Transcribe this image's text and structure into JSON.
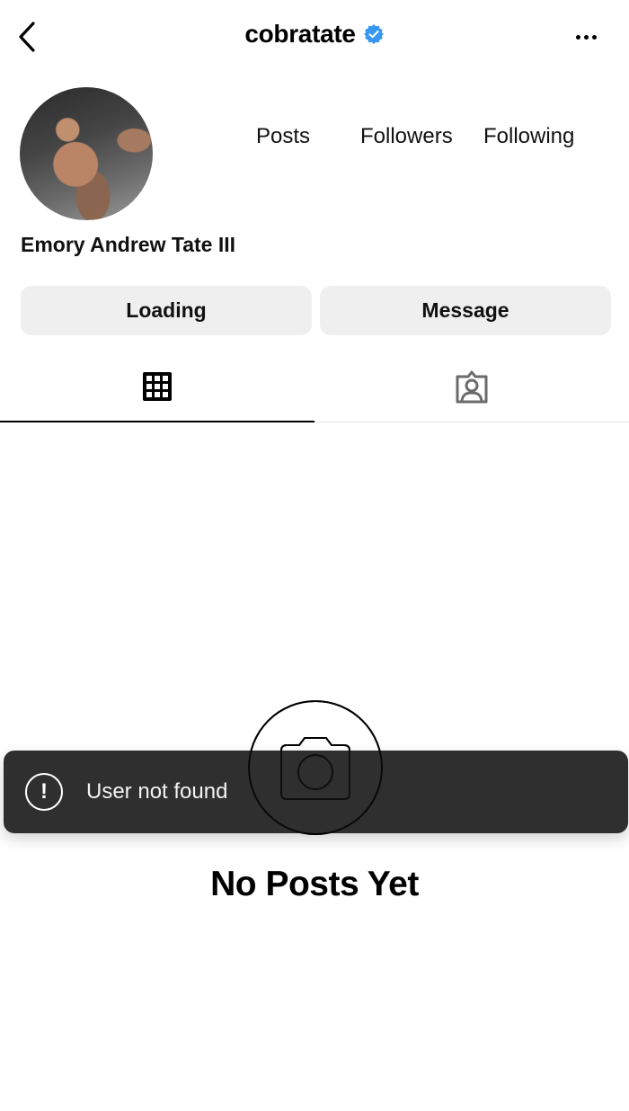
{
  "header": {
    "username": "cobratate",
    "verified": true,
    "back_icon": "chevron-left-icon",
    "more_icon": "more-horizontal-icon",
    "verified_color": "#3897f0"
  },
  "profile": {
    "avatar_alt": "profile photo",
    "full_name": "Emory Andrew Tate III",
    "stats": {
      "posts_label": "Posts",
      "followers_label": "Followers",
      "following_label": "Following"
    }
  },
  "actions": {
    "primary_label": "Loading",
    "message_label": "Message"
  },
  "tabs": [
    {
      "name": "posts-grid",
      "icon": "grid-icon",
      "active": true
    },
    {
      "name": "tagged",
      "icon": "tagged-person-icon",
      "active": false
    }
  ],
  "empty_state": {
    "icon": "camera-icon",
    "title": "No Posts Yet"
  },
  "toast": {
    "icon": "exclamation-circle-icon",
    "icon_glyph": "!",
    "message": "User not found"
  }
}
